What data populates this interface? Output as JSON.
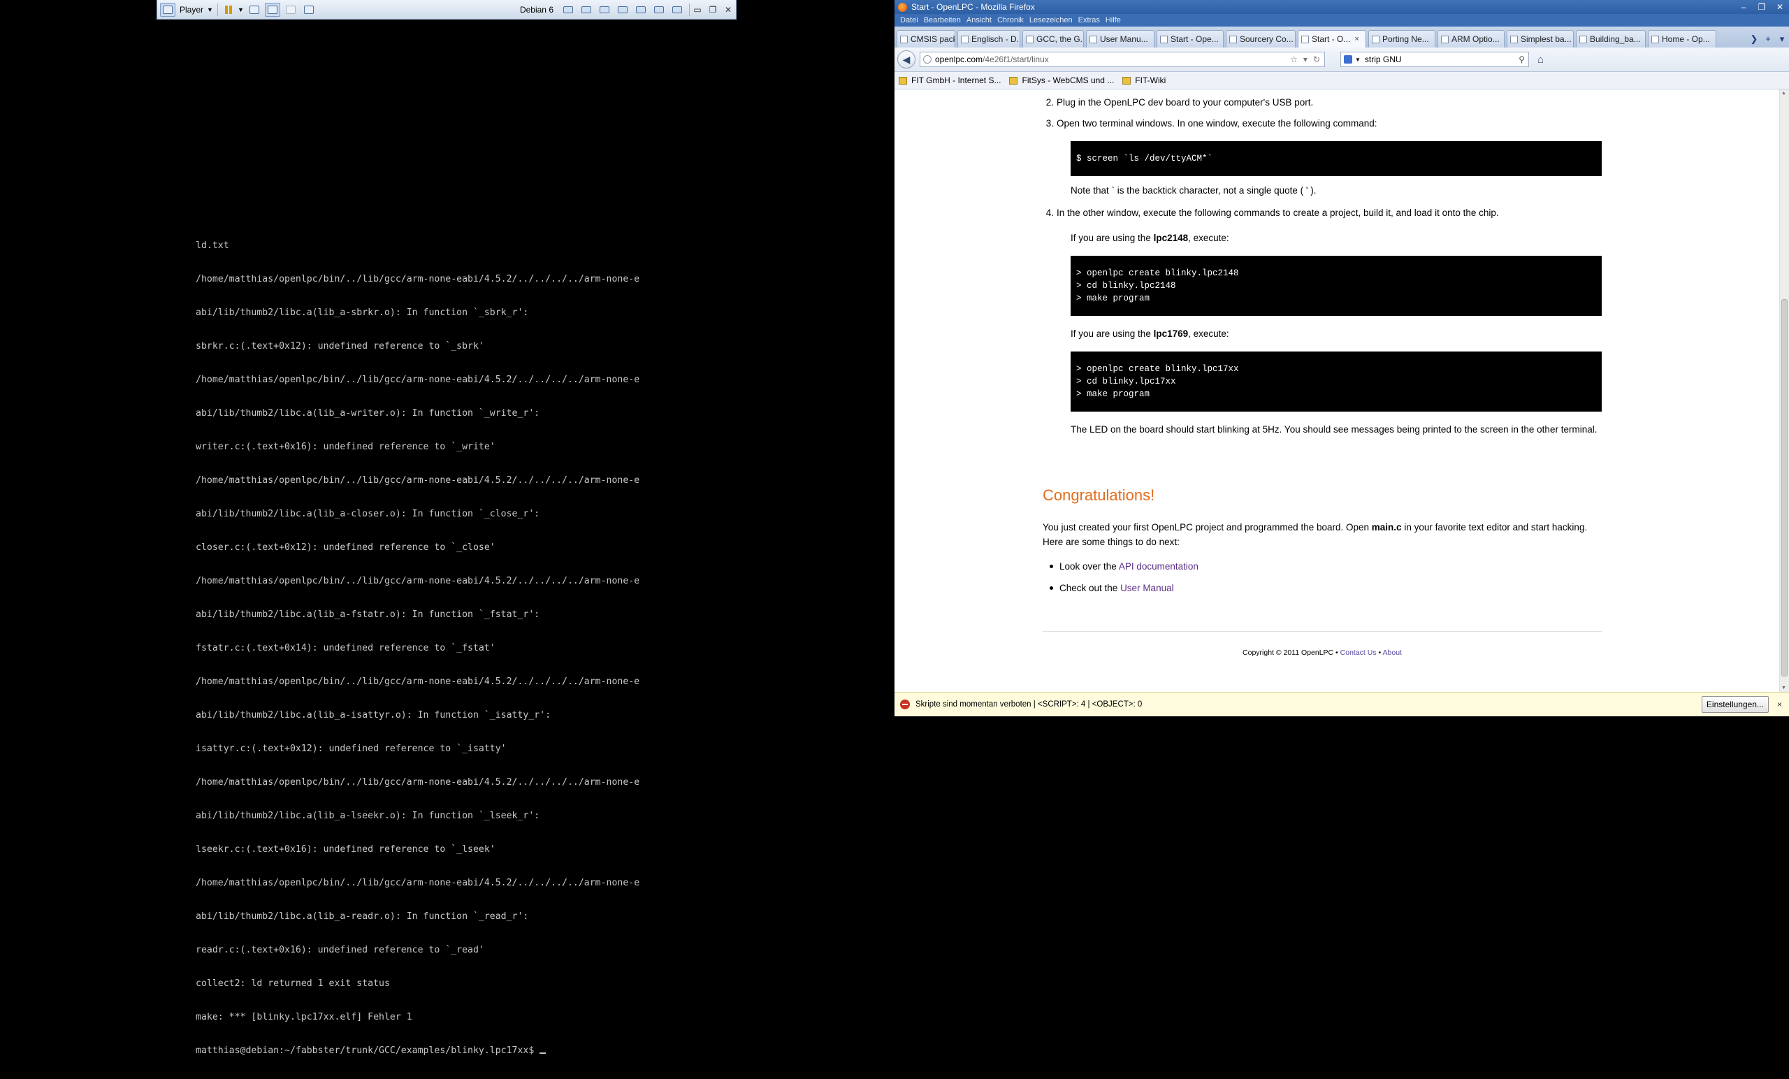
{
  "vm": {
    "player_label": "Player",
    "vm_name": "Debian 6",
    "icons": [
      "vmware-logo-icon",
      "player-menu-caret-icon",
      "pause-icon",
      "pause-caret-icon",
      "send-ctrl-alt-del-icon",
      "fit-guest-icon",
      "fullscreen-icon",
      "unity-icon",
      "unity2-icon",
      "usb-device-icon",
      "network-device-icon",
      "disk-device-icon",
      "floppy-device-icon",
      "printer-device-icon",
      "camera-device-icon",
      "sound-device-icon",
      "minimize-icon",
      "restore-icon",
      "close-icon"
    ]
  },
  "terminal": {
    "lines": [
      "ld.txt",
      "/home/matthias/openlpc/bin/../lib/gcc/arm-none-eabi/4.5.2/../../../../arm-none-e",
      "abi/lib/thumb2/libc.a(lib_a-sbrkr.o): In function `_sbrk_r':",
      "sbrkr.c:(.text+0x12): undefined reference to `_sbrk'",
      "/home/matthias/openlpc/bin/../lib/gcc/arm-none-eabi/4.5.2/../../../../arm-none-e",
      "abi/lib/thumb2/libc.a(lib_a-writer.o): In function `_write_r':",
      "writer.c:(.text+0x16): undefined reference to `_write'",
      "/home/matthias/openlpc/bin/../lib/gcc/arm-none-eabi/4.5.2/../../../../arm-none-e",
      "abi/lib/thumb2/libc.a(lib_a-closer.o): In function `_close_r':",
      "closer.c:(.text+0x12): undefined reference to `_close'",
      "/home/matthias/openlpc/bin/../lib/gcc/arm-none-eabi/4.5.2/../../../../arm-none-e",
      "abi/lib/thumb2/libc.a(lib_a-fstatr.o): In function `_fstat_r':",
      "fstatr.c:(.text+0x14): undefined reference to `_fstat'",
      "/home/matthias/openlpc/bin/../lib/gcc/arm-none-eabi/4.5.2/../../../../arm-none-e",
      "abi/lib/thumb2/libc.a(lib_a-isattyr.o): In function `_isatty_r':",
      "isattyr.c:(.text+0x12): undefined reference to `_isatty'",
      "/home/matthias/openlpc/bin/../lib/gcc/arm-none-eabi/4.5.2/../../../../arm-none-e",
      "abi/lib/thumb2/libc.a(lib_a-lseekr.o): In function `_lseek_r':",
      "lseekr.c:(.text+0x16): undefined reference to `_lseek'",
      "/home/matthias/openlpc/bin/../lib/gcc/arm-none-eabi/4.5.2/../../../../arm-none-e",
      "abi/lib/thumb2/libc.a(lib_a-readr.o): In function `_read_r':",
      "readr.c:(.text+0x16): undefined reference to `_read'",
      "collect2: ld returned 1 exit status",
      "make: *** [blinky.lpc17xx.elf] Fehler 1"
    ],
    "prompt": "matthias@debian:~/fabbster/trunk/GCC/examples/blinky.lpc17xx$ "
  },
  "firefox": {
    "window_title": "Start - OpenLPC - Mozilla Firefox",
    "menu": [
      "Datei",
      "Bearbeiten",
      "Ansicht",
      "Chronik",
      "Lesezeichen",
      "Extras",
      "Hilfe"
    ],
    "tabs": [
      {
        "label": "CMSIS pack..."
      },
      {
        "label": "Englisch - D..."
      },
      {
        "label": "GCC, the G..."
      },
      {
        "label": "User Manu..."
      },
      {
        "label": "Start - Ope..."
      },
      {
        "label": "Sourcery Co..."
      },
      {
        "label": "Start - O...",
        "active": true
      },
      {
        "label": "Porting Ne..."
      },
      {
        "label": "ARM Optio..."
      },
      {
        "label": "Simplest ba..."
      },
      {
        "label": "Building_ba..."
      },
      {
        "label": "Home - Op..."
      }
    ],
    "tab_close": "×",
    "url_domain": "openlpc.com",
    "url_path": "/4e26f1/start/linux",
    "search_value": "strip GNU",
    "bookmarks": [
      "FIT GmbH - Internet S...",
      "FitSys - WebCMS und ...",
      "FIT-Wiki"
    ],
    "notification": {
      "text": "Skripte sind momentan verboten | <SCRIPT>: 4 | <OBJECT>: 0",
      "button": "Einstellungen...",
      "close": "×"
    }
  },
  "page": {
    "step2_num": "2.",
    "step2_text": "Plug in the OpenLPC dev board to your computer's USB port.",
    "step3_num": "3.",
    "step3_text": "Open two terminal windows. In one window, execute the following command:",
    "code1": "$ screen `ls /dev/ttyACM*`",
    "note": "Note that ` is the backtick character, not a single quote ( ' ).",
    "step4_num": "4.",
    "step4_text": "In the other window, execute the following commands to create a project, build it, and load it onto the chip.",
    "lpc2148_pre": "If you are using the ",
    "lpc2148_name": "lpc2148",
    "lpc2148_post": ", execute:",
    "code2": "> openlpc create blinky.lpc2148\n> cd blinky.lpc2148\n> make program",
    "lpc1769_pre": "If you are using the ",
    "lpc1769_name": "lpc1769",
    "lpc1769_post": ", execute:",
    "code3": "> openlpc create blinky.lpc17xx\n> cd blinky.lpc17xx\n> make program",
    "led_text": "The LED on the board should start blinking at 5Hz. You should see messages being printed to the screen in the other terminal.",
    "congrats": "Congratulations!",
    "intro_pre": "You just created your first OpenLPC project and programmed the board. Open ",
    "intro_file": "main.c",
    "intro_post": " in your favorite text editor and start hacking. Here are some things to do next:",
    "bullet1_pre": "Look over the ",
    "bullet1_link": "API documentation",
    "bullet2_pre": "Check out the ",
    "bullet2_link": "User Manual",
    "footer_copy": "Copyright © 2011 OpenLPC • ",
    "footer_contact": "Contact Us",
    "footer_sep": " • ",
    "footer_about": "About"
  }
}
